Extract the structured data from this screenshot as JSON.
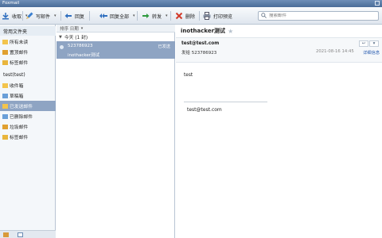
{
  "window": {
    "title": "Foxmail"
  },
  "toolbar": {
    "collect": "收取",
    "compose": "写邮件",
    "reply": "回复",
    "reply_all": "回复全部",
    "forward": "转发",
    "delete": "删除",
    "print_preview": "打印预览",
    "search_placeholder": "搜索邮件"
  },
  "sidebar": {
    "common_folders": "常用文件夹",
    "common_items": [
      {
        "label": "所有未读"
      },
      {
        "label": "置顶邮件"
      },
      {
        "label": "标签邮件"
      }
    ],
    "account": "test(test)",
    "account_items": [
      {
        "label": "收件箱"
      },
      {
        "label": "草稿箱"
      },
      {
        "label": "已发送邮件"
      },
      {
        "label": "已删除邮件"
      },
      {
        "label": "垃圾邮件"
      },
      {
        "label": "标签邮件"
      }
    ],
    "selected": "已发送邮件"
  },
  "list": {
    "sort_label": "排序 日期",
    "group_label": "今天 (1 封)",
    "message": {
      "recipient": "523786923",
      "subject": "inothacker测试",
      "label": "已发送"
    }
  },
  "reader": {
    "subject": "inothacker测试",
    "from": "test@test.com",
    "to_line": "发给 523786923",
    "date": "2021-08-16 14:45",
    "detail_link": "详细信息",
    "body": "test",
    "signature": "test@test.com"
  },
  "colors": {
    "selection": "#8ea4c3",
    "titlebar": "#4a6c98",
    "link": "#2a5db0"
  }
}
